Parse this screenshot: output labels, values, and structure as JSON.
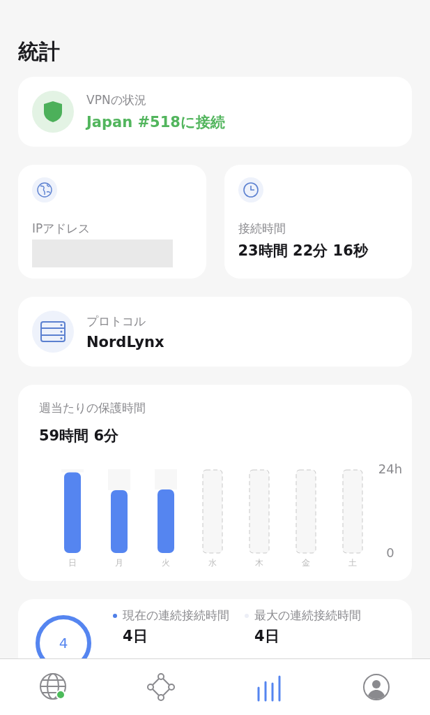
{
  "title": "統計",
  "vpn_status": {
    "label": "VPNの状況",
    "value": "Japan #518に接続",
    "connected": true
  },
  "ip_card": {
    "label": "IPアドレス",
    "value_hidden": true
  },
  "time_card": {
    "label": "接続時間",
    "value": "23時間 22分 16秒"
  },
  "protocol_card": {
    "label": "プロトコル",
    "value": "NordLynx"
  },
  "weekly": {
    "label": "週当たりの保護時間",
    "value": "59時間 6分",
    "chart_data": {
      "type": "bar",
      "categories": [
        "日",
        "月",
        "火",
        "水",
        "木",
        "金",
        "土"
      ],
      "values": [
        23.1,
        18,
        18.2,
        null,
        null,
        null,
        null
      ],
      "ylim": [
        0,
        24
      ],
      "yticks": [
        0,
        {
          "value": 24,
          "label": "24h"
        }
      ]
    }
  },
  "streak": {
    "ring_value": "4",
    "items": [
      {
        "label": "現在の連続接続時間",
        "value": "4日",
        "color": "#4f7fe8"
      },
      {
        "label": "最大の連続接続時間",
        "value": "4日",
        "color": "#eceef6"
      }
    ]
  },
  "tab_bar": [
    {
      "kind": "globe",
      "selected": false,
      "connected": true
    },
    {
      "kind": "meshnet",
      "selected": false
    },
    {
      "kind": "stats",
      "selected": true
    },
    {
      "kind": "profile",
      "selected": false
    }
  ]
}
